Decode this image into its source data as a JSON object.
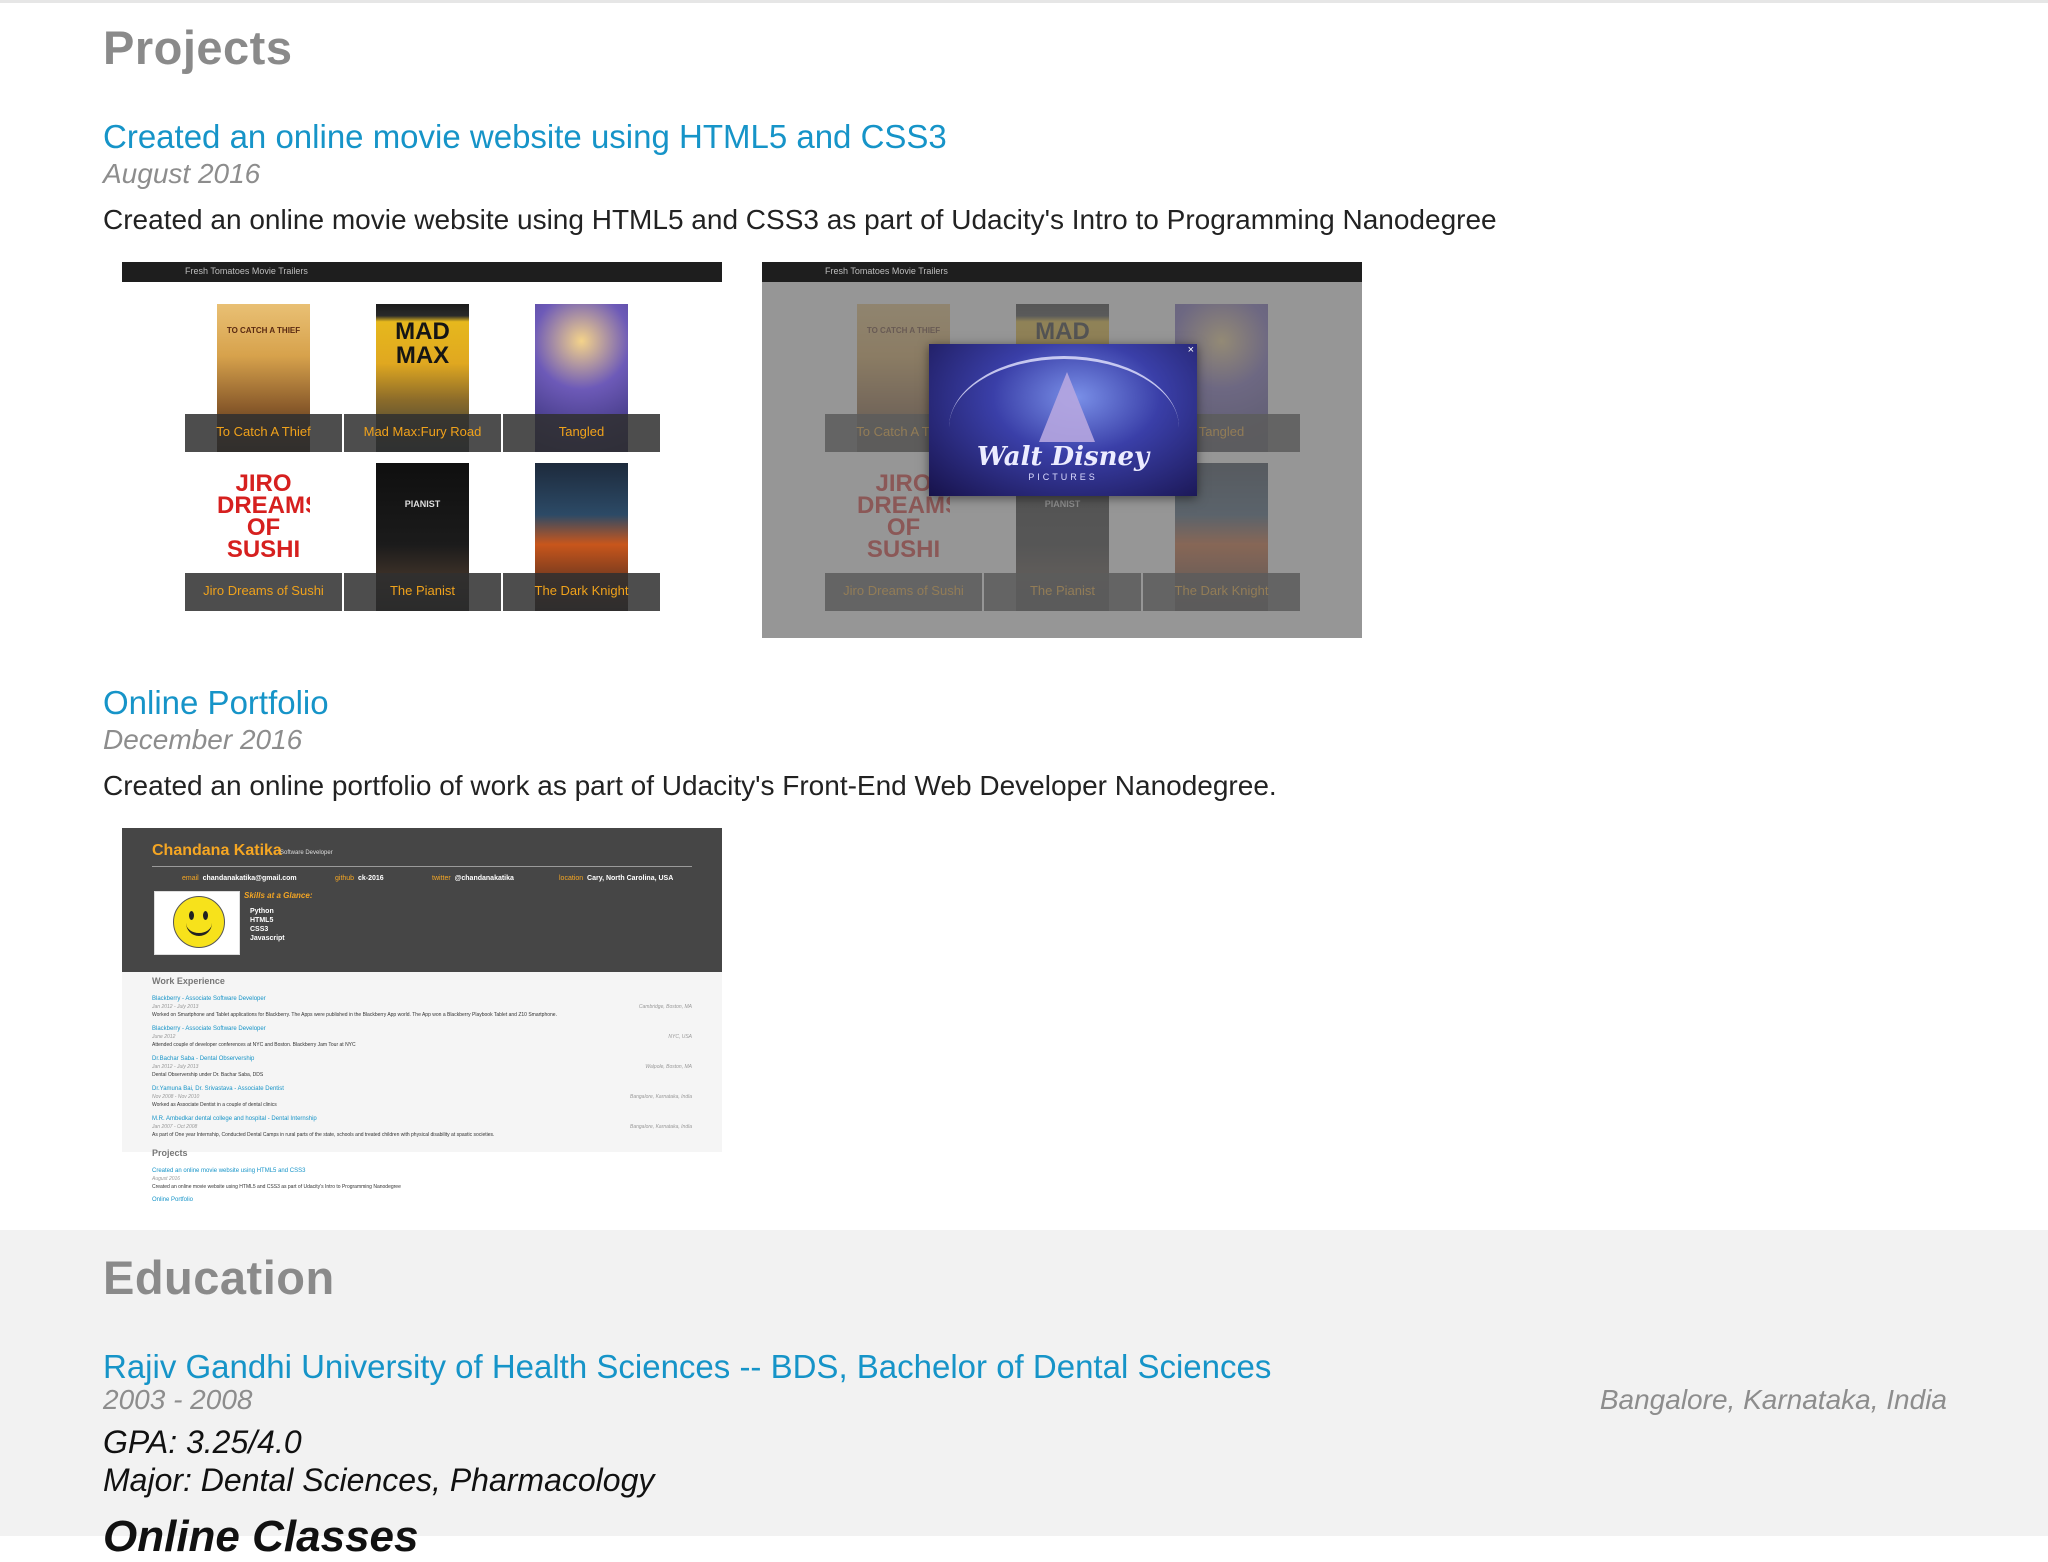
{
  "projects": {
    "heading": "Projects",
    "items": [
      {
        "title": "Created an online movie website using HTML5 and CSS3",
        "date": "August 2016",
        "description": "Created an online movie website using HTML5 and CSS3 as part of Udacity's Intro to Programming Nanodegree"
      },
      {
        "title": "Online Portfolio",
        "date": "December 2016",
        "description": "Created an online portfolio of work as part of Udacity's Front-End Web Developer Nanodegree."
      }
    ]
  },
  "movie_site": {
    "header": "Fresh Tomatoes Movie Trailers",
    "movies": [
      {
        "title": "To Catch A Thief",
        "poster_text": "TO CATCH A THIEF"
      },
      {
        "title": "Mad Max:Fury Road",
        "poster_text": "MAD MAX"
      },
      {
        "title": "Tangled",
        "poster_text": ""
      },
      {
        "title": "Jiro Dreams of Sushi",
        "poster_text": "JIRO DREAMS OF SUSHI"
      },
      {
        "title": "The Pianist",
        "poster_text": "PIANIST"
      },
      {
        "title": "The Dark Knight",
        "poster_text": ""
      }
    ],
    "modal": {
      "brand": "Walt Disney",
      "sub": "PICTURES",
      "close": "×"
    }
  },
  "portfolio_preview": {
    "name": "Chandana Katika",
    "role": "Software Developer",
    "contacts": [
      {
        "key": "email",
        "value": "chandanakatika@gmail.com"
      },
      {
        "key": "github",
        "value": "ck-2016"
      },
      {
        "key": "twitter",
        "value": "@chandanakatika"
      },
      {
        "key": "location",
        "value": "Cary, North Carolina, USA"
      }
    ],
    "skills_title": "Skills at a Glance:",
    "skills": [
      "Python",
      "HTML5",
      "CSS3",
      "Javascript"
    ],
    "work_heading": "Work Experience",
    "jobs": [
      {
        "title": "Blackberry - Associate Software Developer",
        "dates": "Jan 2012 - July 2013",
        "location": "Cambridge, Boston, MA",
        "desc": "Worked on Smartphone and Tablet applications for Blackberry. The Apps were published in the Blackberry App world. The App won a Blackberry Playbook Tablet and Z10 Smartphone."
      },
      {
        "title": "Blackberry - Associate Software Developer",
        "dates": "June 2012",
        "location": "NYC, USA",
        "desc": "Attended couple of developer conferences at NYC and Boston. Blackberry Jam Tour at NYC"
      },
      {
        "title": "Dr.Bachar Saba - Dental Observership",
        "dates": "Jan 2012 - July 2013",
        "location": "Walpole, Boston, MA",
        "desc": "Dental Observership under Dr. Bachar Saba, DDS"
      },
      {
        "title": "Dr.Yamuna Bai, Dr. Srivastava - Associate Dentist",
        "dates": "Nov 2008 - Nov 2010",
        "location": "Bangalore, Karnataka, India",
        "desc": "Worked as Associate Dentist in a couple of dental clinics"
      },
      {
        "title": "M.R. Ambedkar dental college and hospital - Dental Internship",
        "dates": "Jan 2007 - Oct 2008",
        "location": "Bangalore, Karnataka, India",
        "desc": "As part of One year Internship, Conducted Dental Camps in rural parts of the state, schools and treated children with physical disability at spastic societies."
      }
    ],
    "projects_heading": "Projects",
    "project_link": "Created an online movie website using HTML5 and CSS3",
    "project_date": "August 2016",
    "project_desc": "Created an online movie website using HTML5 and CSS3 as part of Udacity's Intro to Programming Nanodegree",
    "next_link": "Online Portfolio"
  },
  "education": {
    "heading": "Education",
    "school": "Rajiv Gandhi University of Health Sciences -- BDS, Bachelor of Dental Sciences",
    "dates": "2003 - 2008",
    "location": "Bangalore, Karnataka, India",
    "gpa": "GPA: 3.25/4.0",
    "major": "Major: Dental Sciences, Pharmacology",
    "online_heading": "Online Classes"
  }
}
